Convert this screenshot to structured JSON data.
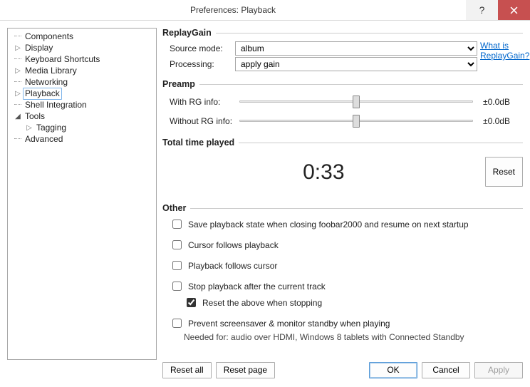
{
  "window": {
    "title": "Preferences: Playback",
    "help_glyph": "?",
    "close_label": "Close"
  },
  "tree": {
    "items": [
      {
        "label": "Components",
        "glyph": "dots"
      },
      {
        "label": "Display",
        "glyph": "▷"
      },
      {
        "label": "Keyboard Shortcuts",
        "glyph": "dots"
      },
      {
        "label": "Media Library",
        "glyph": "▷"
      },
      {
        "label": "Networking",
        "glyph": "dots"
      },
      {
        "label": "Playback",
        "glyph": "▷",
        "selected": true
      },
      {
        "label": "Shell Integration",
        "glyph": "dots"
      },
      {
        "label": "Tools",
        "glyph": "▲",
        "expanded": true,
        "children": [
          {
            "label": "Tagging",
            "glyph": "▷"
          }
        ]
      },
      {
        "label": "Advanced",
        "glyph": "dots"
      }
    ]
  },
  "replaygain": {
    "title": "ReplayGain",
    "source_label": "Source mode:",
    "source_value": "album",
    "processing_label": "Processing:",
    "processing_value": "apply gain",
    "help_text": "What is ReplayGain?"
  },
  "preamp": {
    "title": "Preamp",
    "with_label": "With RG info:",
    "with_value": "±0.0dB",
    "without_label": "Without RG info:",
    "without_value": "±0.0dB"
  },
  "total": {
    "title": "Total time played",
    "value": "0:33",
    "reset_label": "Reset"
  },
  "other": {
    "title": "Other",
    "save_state": "Save playback state when closing foobar2000 and resume on next startup",
    "cursor_follows": "Cursor follows playback",
    "playback_follows": "Playback follows cursor",
    "stop_after": "Stop playback after the current track",
    "reset_when_stop": "Reset the above when stopping",
    "reset_when_stop_checked": true,
    "prevent_screensaver": "Prevent screensaver & monitor standby when playing",
    "screensaver_hint": "Needed for: audio over HDMI, Windows 8 tablets with Connected Standby"
  },
  "footer": {
    "reset_all": "Reset all",
    "reset_page": "Reset page",
    "ok": "OK",
    "cancel": "Cancel",
    "apply": "Apply"
  }
}
